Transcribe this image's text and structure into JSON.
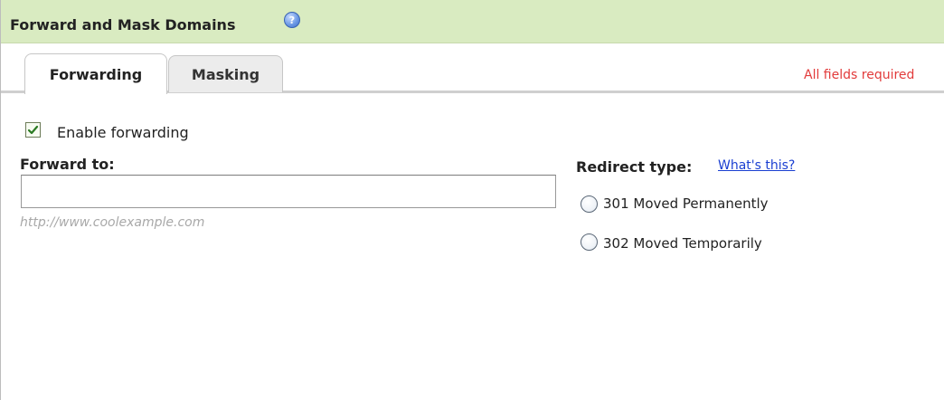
{
  "header": {
    "title": "Forward and Mask Domains",
    "help_icon": "help-circle-icon"
  },
  "tabs": [
    {
      "label": "Forwarding",
      "active": true
    },
    {
      "label": "Masking",
      "active": false
    }
  ],
  "required_note": "All fields required",
  "forwarding": {
    "enable_label": "Enable forwarding",
    "enable_checked": true,
    "forward_to_label": "Forward to:",
    "forward_to_value": "",
    "forward_to_hint": "http://www.coolexample.com",
    "redirect_type_label": "Redirect type:",
    "whats_this_link": "What's this?",
    "redirect_options": [
      {
        "label": "301 Moved Permanently",
        "selected": false
      },
      {
        "label": "302 Moved Temporarily",
        "selected": false
      }
    ]
  },
  "colors": {
    "header_bg": "#d9ebc1",
    "required_text": "#e23b3b",
    "link": "#1a3fd1"
  }
}
